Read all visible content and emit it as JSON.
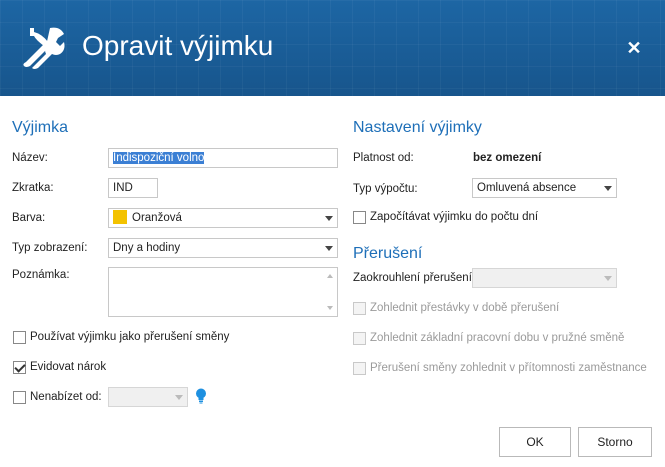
{
  "window": {
    "title": "Opravit výjimku"
  },
  "left": {
    "heading": "Výjimka",
    "name_label": "Název:",
    "name_value": "Indispoziční volno",
    "abbr_label": "Zkratka:",
    "abbr_value": "IND",
    "color_label": "Barva:",
    "color_value": "Oranžová",
    "display_label": "Typ zobrazení:",
    "display_value": "Dny a hodiny",
    "note_label": "Poznámka:",
    "use_as_interrupt_label": "Používat výjimku jako přerušení směny",
    "track_claim_label": "Evidovat nárok",
    "do_not_offer_label": "Nenabízet od:"
  },
  "right": {
    "heading": "Nastavení výjimky",
    "validity_label": "Platnost od:",
    "validity_value": "bez omezení",
    "calc_label": "Typ výpočtu:",
    "calc_value": "Omluvená absence",
    "count_days_label": "Započítávat výjimku do počtu dní",
    "interrupt_heading": "Přerušení",
    "rounding_label": "Zaokrouhlení přerušení:",
    "opt1": "Zohlednit přestávky v době přerušení",
    "opt2": "Zohlednit základní pracovní dobu v pružné směně",
    "opt3": "Přerušení směny zohlednit v přítomnosti zaměstnance"
  },
  "buttons": {
    "ok": "OK",
    "cancel": "Storno"
  },
  "colors": {
    "accent": "#1e6fb8",
    "titlebar": "#1b5f9a",
    "swatch": "#f3c200",
    "bulb": "#1e90e0"
  },
  "icons": {
    "title": "tools-icon",
    "close": "close-icon",
    "hint": "lightbulb-icon"
  },
  "state": {
    "use_as_interrupt": false,
    "track_claim": true,
    "do_not_offer": false,
    "count_days": false
  }
}
